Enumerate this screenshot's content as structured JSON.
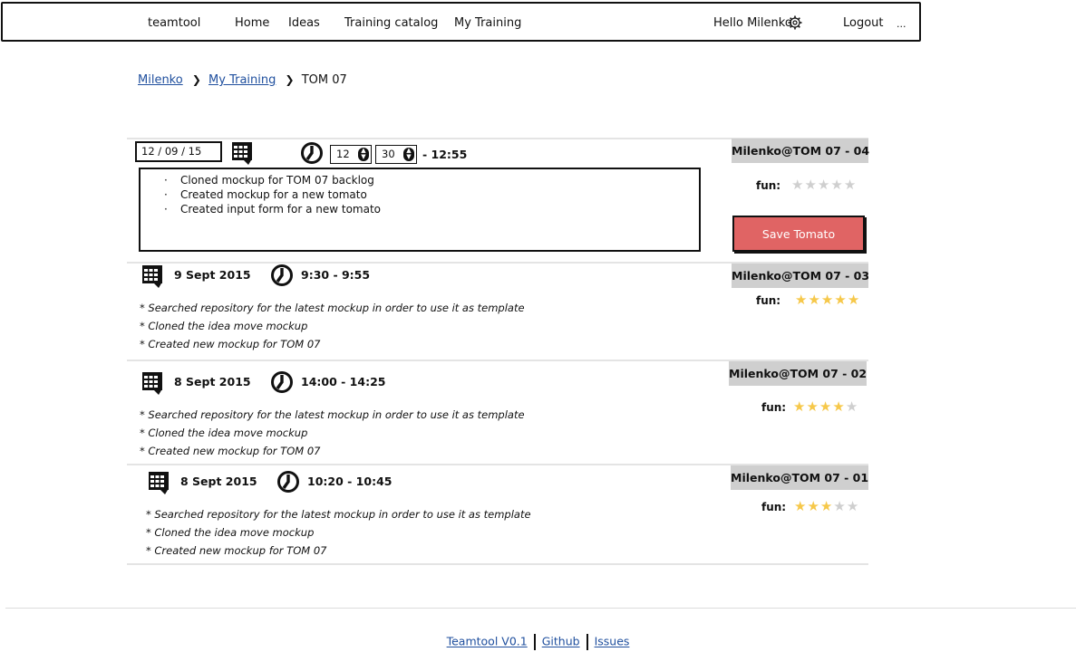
{
  "nav": {
    "brand": "teamtool",
    "links": [
      "Home",
      "Ideas",
      "Training catalog",
      "My Training"
    ],
    "greeting": "Hello Milenko",
    "logout": "Logout",
    "more": "..."
  },
  "breadcrumb": {
    "items": [
      "Milenko",
      "My Training"
    ],
    "current": "TOM 07"
  },
  "form": {
    "date": "12 / 09 / 15",
    "hour": "12",
    "minute": "30",
    "end_time": "- 12:55",
    "notes": [
      "Cloned mockup for TOM 07 backlog",
      "Created mockup for a new tomato",
      "Created input form for a new tomato"
    ],
    "tag": "Milenko@TOM 07 - 04",
    "fun_label": "fun:",
    "fun_rating": 0,
    "save_label": "Save Tomato"
  },
  "entries": [
    {
      "date": "9 Sept 2015",
      "time": "9:30 - 9:55",
      "tag": "Milenko@TOM 07 - 03",
      "fun_label": "fun:",
      "fun_rating": 5,
      "notes": [
        "* Searched repository for the latest mockup in order to use it as template",
        "* Cloned the idea move mockup",
        "* Created new mockup for TOM 07"
      ]
    },
    {
      "date": "8 Sept 2015",
      "time": "14:00 - 14:25",
      "tag": "Milenko@TOM 07 - 02",
      "fun_label": "fun:",
      "fun_rating": 4,
      "notes": [
        "* Searched repository for the latest mockup in order to use it as template",
        "* Cloned the idea move mockup",
        "* Created new mockup for TOM 07"
      ]
    },
    {
      "date": "8 Sept 2015",
      "time": "10:20 - 10:45",
      "tag": "Milenko@TOM 07 - 01",
      "fun_label": "fun:",
      "fun_rating": 3,
      "notes": [
        "* Searched repository for the latest mockup in order to use it as template",
        "* Cloned the idea move mockup",
        "* Created new mockup for TOM 07"
      ]
    }
  ],
  "footer": {
    "links": [
      "Teamtool V0.1",
      "Github",
      "Issues"
    ]
  },
  "icons": {
    "calendar": "calendar-icon",
    "clock": "clock-icon",
    "settings": "gear-icon",
    "spinner": "spinner-arrows-icon",
    "breadcrumb_separator": "chevron-right-icon",
    "rating": "star-icon"
  },
  "colors": {
    "save_button": "#e06464",
    "tag_background": "#cfcfcf",
    "star_filled": "#f6c84a",
    "star_empty": "#cfcfcf",
    "link": "#1f4f9e"
  }
}
